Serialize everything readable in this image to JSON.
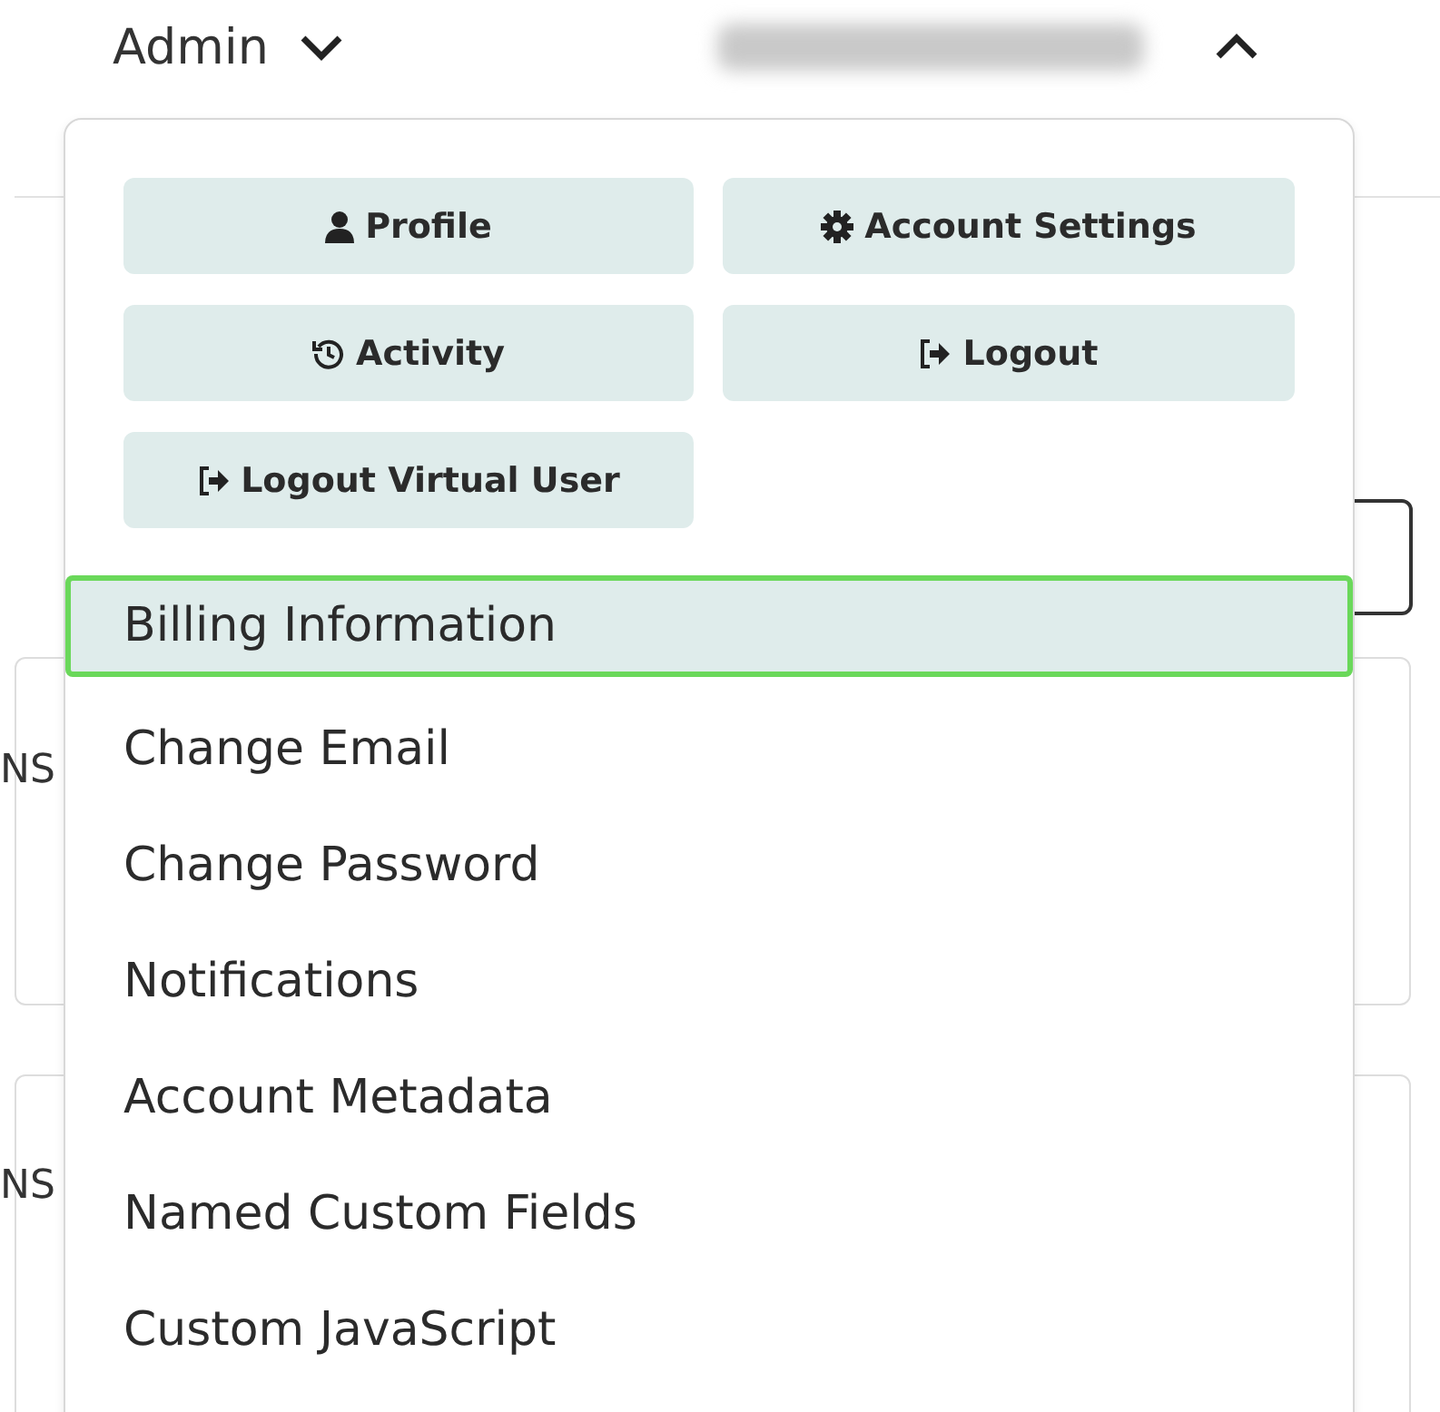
{
  "header": {
    "menu_label": "Admin",
    "user_menu_expanded": true
  },
  "background": {
    "fragments": [
      "NS",
      "NS"
    ]
  },
  "quick_buttons": [
    {
      "label": "Profile",
      "kind": "user"
    },
    {
      "label": "Account Settings",
      "kind": "gear"
    },
    {
      "label": "Activity",
      "kind": "history"
    },
    {
      "label": "Logout",
      "kind": "signout"
    },
    {
      "label": "Logout Virtual User",
      "kind": "signout"
    }
  ],
  "menu_items": [
    {
      "label": "Billing Information",
      "selected": true
    },
    {
      "label": "Change Email",
      "selected": false
    },
    {
      "label": "Change Password",
      "selected": false
    },
    {
      "label": "Notifications",
      "selected": false
    },
    {
      "label": "Account Metadata",
      "selected": false
    },
    {
      "label": "Named Custom Fields",
      "selected": false
    },
    {
      "label": "Custom JavaScript",
      "selected": false
    }
  ]
}
